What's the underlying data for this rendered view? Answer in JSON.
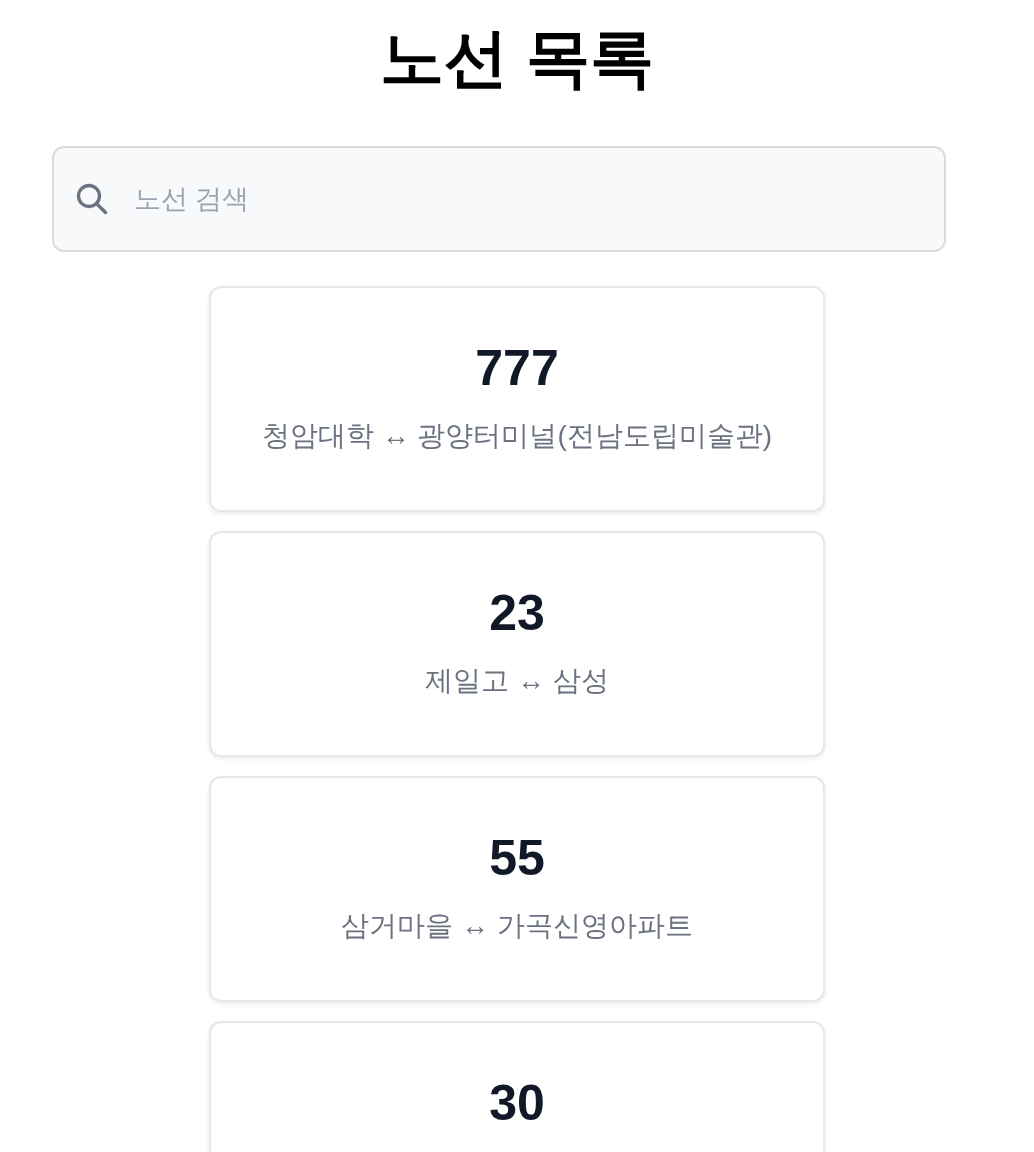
{
  "title": "노선 목록",
  "search": {
    "placeholder": "노선 검색"
  },
  "routes": [
    {
      "number": "777",
      "route": "청암대학 ↔ 광양터미널(전남도립미술관)"
    },
    {
      "number": "23",
      "route": "제일고 ↔ 삼성"
    },
    {
      "number": "55",
      "route": "삼거마을 ↔ 가곡신영아파트"
    },
    {
      "number": "30"
    }
  ]
}
